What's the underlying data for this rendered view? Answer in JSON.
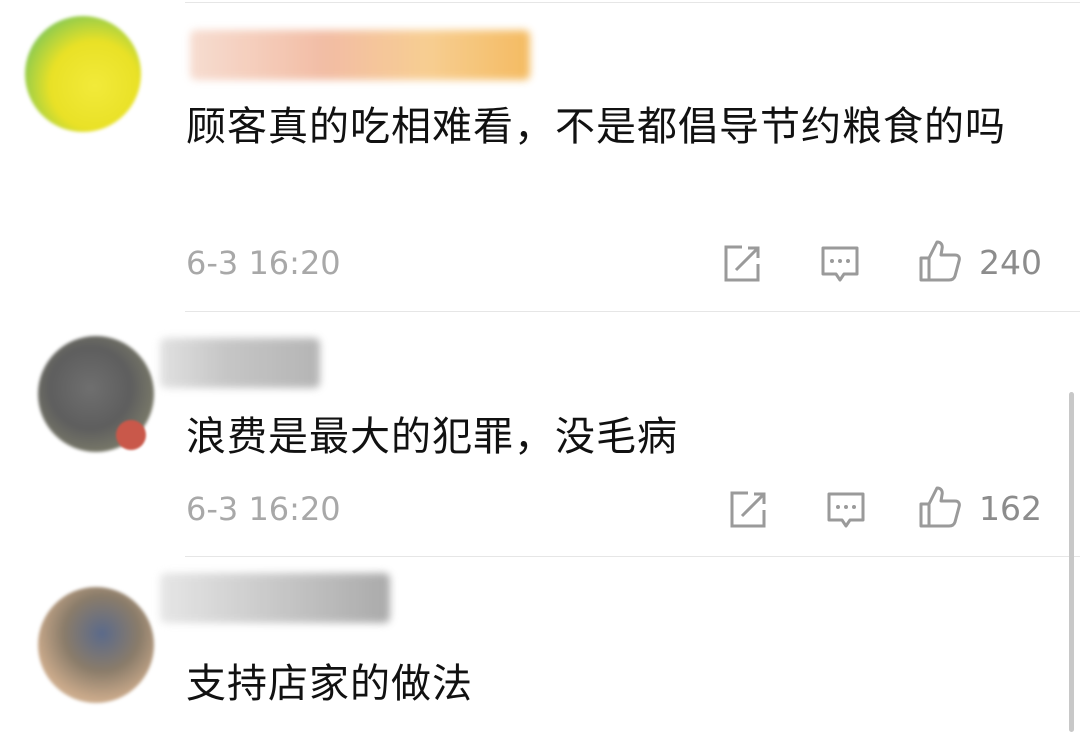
{
  "comments": [
    {
      "text": "顾客真的吃相难看，不是都倡导节约粮食的吗",
      "timestamp": "6-3 16:20",
      "likes": "240"
    },
    {
      "text": "浪费是最大的犯罪，没毛病",
      "timestamp": "6-3 16:20",
      "likes": "162"
    },
    {
      "text": "支持店家的做法"
    }
  ],
  "icons": {
    "share": "share-icon",
    "reply": "comment-icon",
    "like": "thumbs-up-icon"
  },
  "colors": {
    "text": "#111111",
    "meta": "#a8a8a8",
    "icon": "#9a9a9a"
  }
}
